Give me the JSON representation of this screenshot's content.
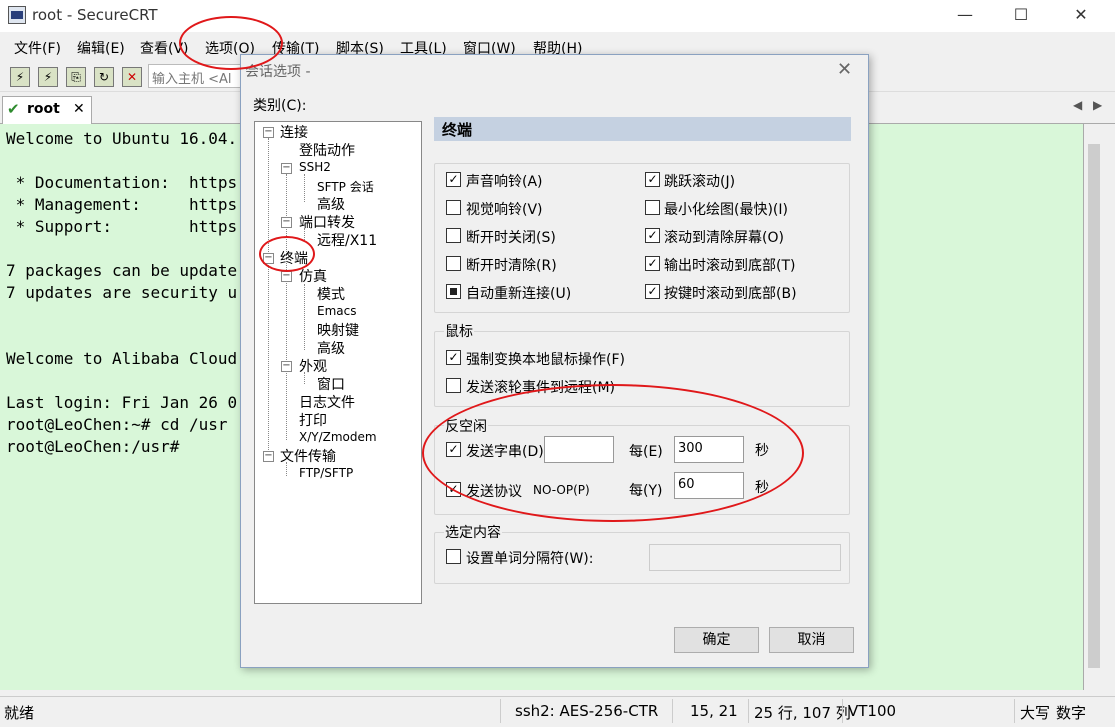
{
  "window": {
    "title": "root - SecureCRT",
    "minimize": "—",
    "maximize": "☐",
    "close": "✕"
  },
  "menu": [
    "文件(F)",
    "编辑(E)",
    "查看(V)",
    "选项(O)",
    "传输(T)",
    "脚本(S)",
    "工具(L)",
    "窗口(W)",
    "帮助(H)"
  ],
  "toolbar": {
    "host_placeholder": "输入主机 <Al"
  },
  "tab": {
    "label": "root",
    "close": "✕",
    "left_arrow": "◀",
    "right_arrow": "▶"
  },
  "terminal": {
    "lines": [
      "Welcome to Ubuntu 16.04.",
      "",
      " * Documentation:  https",
      " * Management:     https",
      " * Support:        https",
      "",
      "7 packages can be update",
      "7 updates are security u",
      "",
      "",
      "Welcome to Alibaba Cloud",
      "",
      "Last login: Fri Jan 26 0",
      "root@LeoChen:~# cd /usr",
      "root@LeoChen:/usr#"
    ]
  },
  "status": {
    "ready": "就绪",
    "cipher": "ssh2: AES-256-CTR",
    "position": "15, 21",
    "size": "25 行, 107 列",
    "emulation": "VT100",
    "caps": "大写",
    "num": "数字"
  },
  "dialog": {
    "title": "会话选项 -",
    "close": "✕",
    "category_label": "类别(C):",
    "tree": [
      "连接",
      "登陆动作",
      "SSH2",
      "SFTP 会话",
      "高级",
      "端口转发",
      "远程/X11",
      "终端",
      "仿真",
      "模式",
      "Emacs",
      "映射键",
      "高级",
      "外观",
      "窗口",
      "日志文件",
      "打印",
      "X/Y/Zmodem",
      "文件传输",
      "FTP/SFTP"
    ],
    "section": "终端",
    "general": [
      {
        "label": "声音响铃(A)",
        "checked": true
      },
      {
        "label": "跳跃滚动(J)",
        "checked": true
      },
      {
        "label": "视觉响铃(V)",
        "checked": false
      },
      {
        "label": "最小化绘图(最快)(I)",
        "checked": false
      },
      {
        "label": "断开时关闭(S)",
        "checked": false
      },
      {
        "label": "滚动到清除屏幕(O)",
        "checked": true
      },
      {
        "label": "断开时清除(R)",
        "checked": false
      },
      {
        "label": "输出时滚动到底部(T)",
        "checked": true
      },
      {
        "label": "自动重新连接(U)",
        "checked": "partial"
      },
      {
        "label": "按键时滚动到底部(B)",
        "checked": true
      }
    ],
    "mouse": {
      "label": "鼠标",
      "items": [
        {
          "label": "强制变换本地鼠标操作(F)",
          "checked": true
        },
        {
          "label": "发送滚轮事件到远程(M)",
          "checked": false
        }
      ]
    },
    "antiidle": {
      "label": "反空闲",
      "send_string": {
        "label": "发送字串(D)",
        "checked": true,
        "value": "",
        "every": "每(E)",
        "seconds": "300",
        "unit": "秒"
      },
      "send_protocol": {
        "label": "发送协议",
        "protocol": "NO-OP(P)",
        "checked": true,
        "every": "每(Y)",
        "seconds": "60",
        "unit": "秒"
      }
    },
    "selection": {
      "label": "选定内容",
      "word_delim": {
        "label": "设置单词分隔符(W):",
        "checked": false,
        "value": ""
      }
    },
    "ok": "确定",
    "cancel": "取消"
  }
}
